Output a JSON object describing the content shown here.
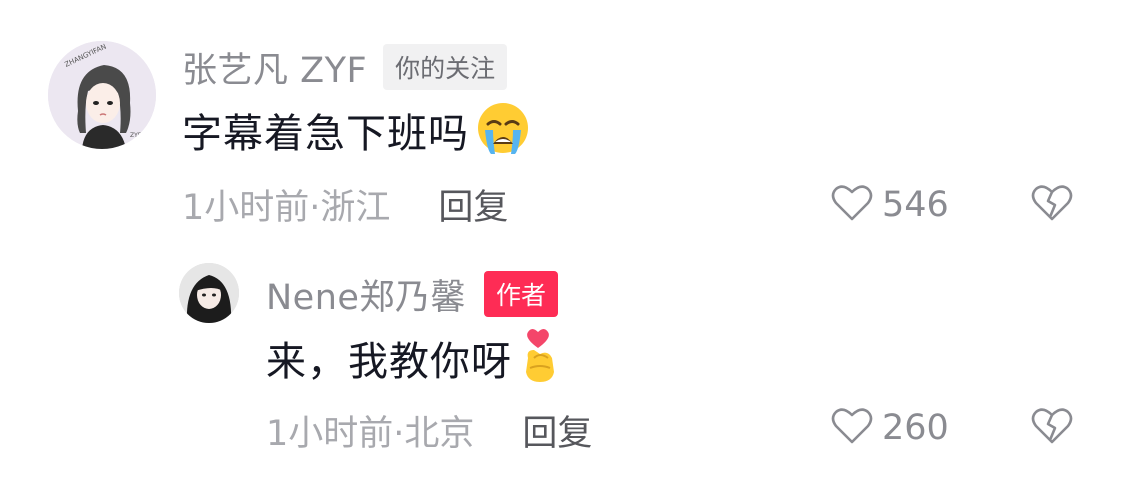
{
  "comments": [
    {
      "username": "张艺凡 ZYF",
      "badge": "你的关注",
      "text": "字幕着急下班吗",
      "emoji": "loudly-crying-face",
      "avatar_text": "ZHANGYIFAN",
      "avatar_signature": "ZYF",
      "time_location": "1小时前·浙江",
      "reply_label": "回复",
      "like_count": "546",
      "like_icon": "heart-outline-icon",
      "dislike_icon": "broken-heart-icon"
    },
    {
      "username": "Nene郑乃馨",
      "badge": "作者",
      "text": "来，我教你呀",
      "emoji": "finger-heart",
      "time_location": "1小时前·北京",
      "reply_label": "回复",
      "like_count": "260",
      "like_icon": "heart-outline-icon",
      "dislike_icon": "broken-heart-icon"
    }
  ],
  "colors": {
    "author_badge": "#fe2c55",
    "follow_badge_bg": "#f1f1f2",
    "username": "#8a8b91",
    "meta": "#a8a9ae"
  }
}
